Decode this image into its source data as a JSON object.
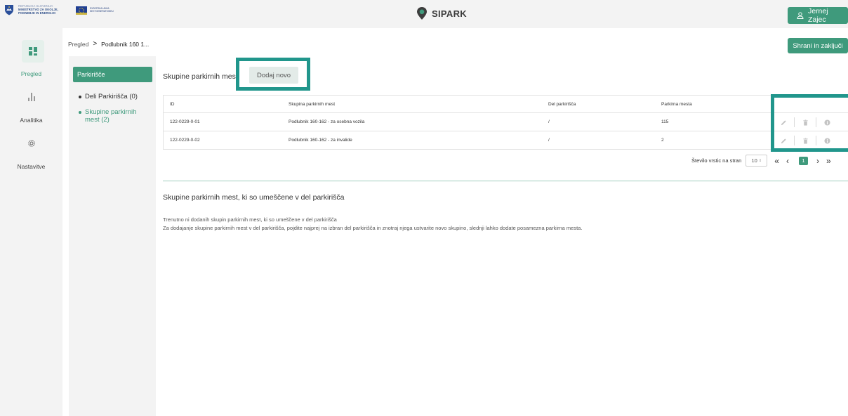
{
  "header": {
    "gov_logo": {
      "lines": [
        "REPUBLIKA SLOVENIJA",
        "MINISTRSTVO ZA OKOLJE,",
        "PODNEBJE IN ENERGIJO"
      ]
    },
    "eu_logo": {
      "lines": [
        "EVROPSKA UNIJA",
        "NEXTGENERATIONEU"
      ]
    },
    "brand": "SIPARK",
    "user_name": "Jernej Zajec"
  },
  "nav": {
    "items": [
      {
        "label": "Pregled",
        "icon": "dashboard-icon",
        "active": true
      },
      {
        "label": "Analitika",
        "icon": "bar-chart-icon",
        "active": false
      },
      {
        "label": "Nastavitve",
        "icon": "gear-icon",
        "active": false
      }
    ]
  },
  "breadcrumb": {
    "root": "Pregled",
    "separator": ">",
    "current": "Podlubnik 160 1..."
  },
  "save_button": "Shrani in zaključi",
  "subpanel": {
    "parking_button": "Parkirišče",
    "items": [
      {
        "label": "Deli Parkirišča (0)",
        "active": false
      },
      {
        "label": "Skupine parkirnih mest (2)",
        "active": true
      }
    ]
  },
  "groups": {
    "title": "Skupine parkirnih mest",
    "add_button": "Dodaj novo",
    "columns": [
      "ID",
      "Skupina parkirnih mest",
      "Del parkirišča",
      "Parkirna mesta"
    ],
    "rows": [
      {
        "id": "122-0229-0-01",
        "group": "Podlubnik 160-162 - za osebna vozila",
        "part": "/",
        "spots": "115"
      },
      {
        "id": "122-0229-0-02",
        "group": "Podlubnik 160-162 - za invalide",
        "part": "/",
        "spots": "2"
      }
    ],
    "pager": {
      "rows_label": "Število vrstic na stran",
      "rows_value": "10",
      "page": "1"
    }
  },
  "placed_groups": {
    "title": "Skupine parkirnih mest, ki so umeščene v del parkirišča",
    "empty_text": "Trenutno ni dodanih skupin parkirnih mest, ki so umeščene v del parkirišča",
    "hint_text": "Za dodajanje skupine parkirnih mest v del parkirišča, pojdite najprej na izbran del parkirišča in znotraj njega ustvarite novo skupino, slednji lahko dodate posamezna parkirna mesta."
  },
  "colors": {
    "accent": "#3f9a7c",
    "highlight": "#21968c",
    "panel": "#f3f3f3"
  }
}
